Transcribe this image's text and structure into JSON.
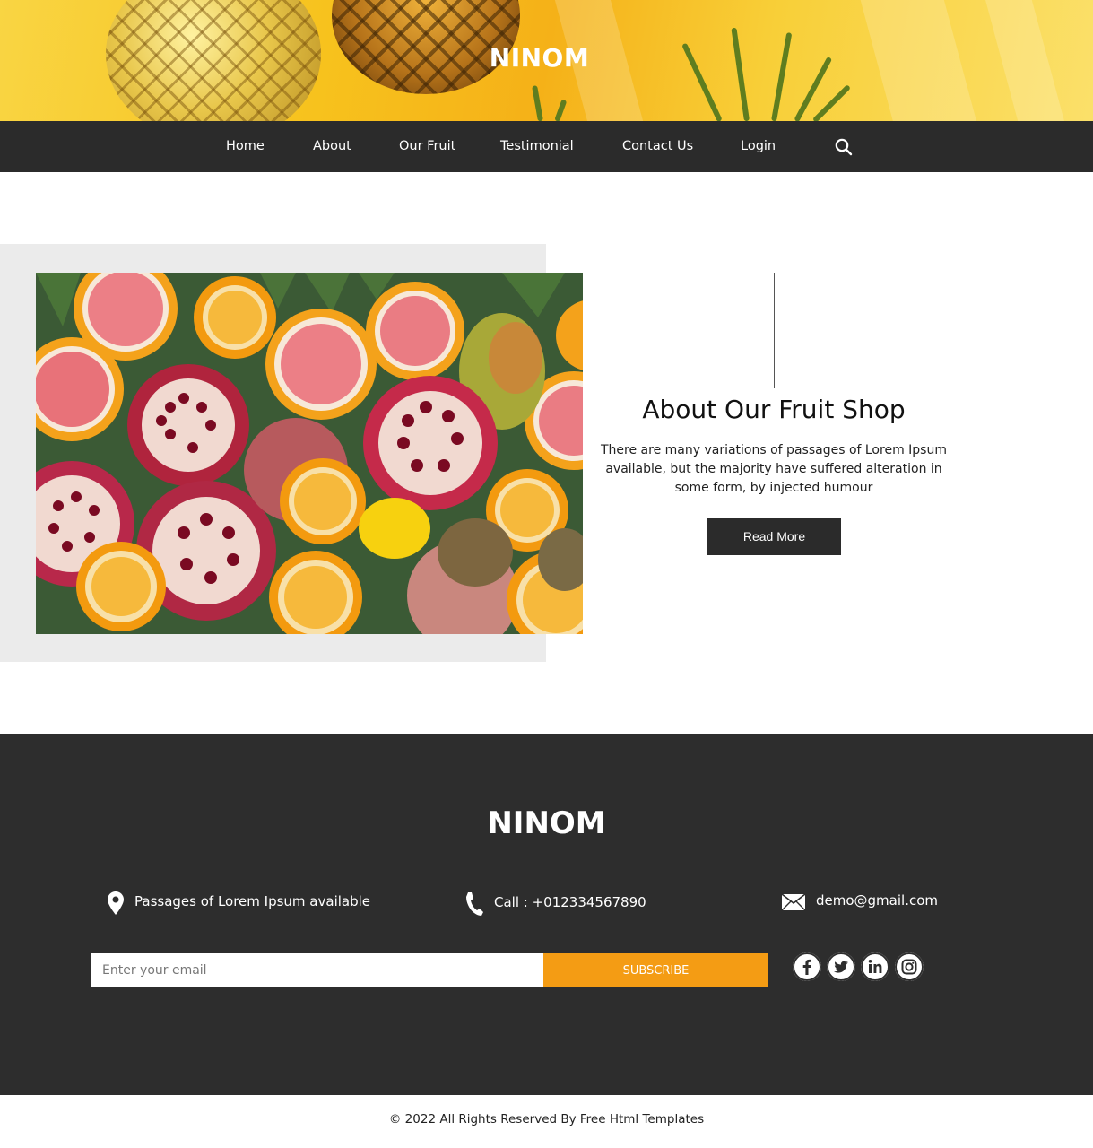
{
  "header": {
    "brand": "NINOM",
    "colors": {
      "banner": "#f7c21d",
      "nav_bg": "#2b2b2b"
    }
  },
  "nav": {
    "items": [
      {
        "label": "Home"
      },
      {
        "label": "About"
      },
      {
        "label": "Our Fruit"
      },
      {
        "label": "Testimonial"
      },
      {
        "label": "Contact Us"
      },
      {
        "label": "Login"
      }
    ],
    "search_icon": "search-icon"
  },
  "about": {
    "title": "About Our Fruit Shop",
    "text": "There are many variations of passages of Lorem Ipsum available, but the majority have suffered alteration in some form, by injected humour",
    "button_label": "Read More",
    "image": "fruit-image"
  },
  "footer": {
    "brand": "NINOM",
    "address": "Passages of Lorem Ipsum available",
    "phone": "Call : +012334567890",
    "email": "demo@gmail.com",
    "subscribe": {
      "placeholder": "Enter your email",
      "value": "",
      "button_label": "SUBSCRIBE"
    },
    "social": [
      "facebook-icon",
      "twitter-icon",
      "linkedin-icon",
      "instagram-icon"
    ],
    "colors": {
      "footer_bg": "#2d2d2d",
      "accent": "#f49c14"
    }
  },
  "copyright": "© 2022 All Rights Reserved By Free Html Templates"
}
